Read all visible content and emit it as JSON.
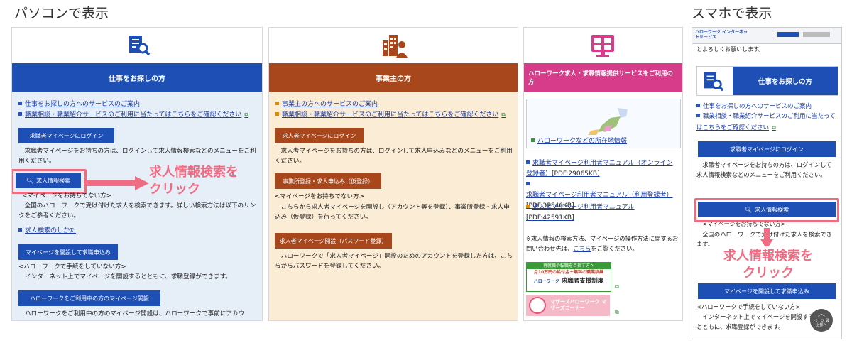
{
  "captions": {
    "pc": "パソコンで表示",
    "sp": "スマホで表示"
  },
  "colors": {
    "job_seeker": "#1d4fb4",
    "employer": "#a8471b",
    "hw_service": "#d63c8a",
    "callout": "#f06c82"
  },
  "p1": {
    "title": "仕事をお探しの方",
    "icon": "document-search-icon",
    "link1": "仕事をお探しの方へのサービスのご案内",
    "link2": "職業相談・職業紹介サービスのご利用に当たってはこちらをご確認ください",
    "login_btn": "求職者マイページにログイン",
    "login_desc": "求職者マイページをお持ちの方は、ログインして求人情報検索などのメニューをご利用ください。",
    "search_btn": "求人情報検索",
    "no_mypage": "<マイページをお持ちでない方>",
    "search_desc": "全国のハローワークで受け付けた求人を検索できます。詳しい検索方法は以下のリンクをご参考ください。",
    "link3": "求人検索のしかた",
    "open_btn": "マイページを開設して求職申込み",
    "no_visit": "<ハローワークで手続をしていない方>",
    "open_desc": "インターネット上でマイページを開設するとともに、求職登録ができます。",
    "hw_btn": "ハローワークをご利用中の方のマイページ開設",
    "hw_desc": "ハローワークをご利用中の方のマイページ開設は、ハローワークで事前にアカウ"
  },
  "p2": {
    "title": "事業主の方",
    "icon": "building-person-icon",
    "link1": "事業主の方へのサービスのご案内",
    "link2": "職業相談・職業紹介サービスのご利用に当たってはこちらをご確認ください",
    "login_btn": "求人者マイページにログイン",
    "login_desc": "求人者マイページをお持ちの方は、ログインして求人申込みなどのメニューをご利用ください。",
    "reg_btn": "事業所登録・求人申込み（仮登録）",
    "no_mypage": "<マイページをお持ちでない方>",
    "reg_desc": "こちらから求人者マイページを開設し（アカウント等を登録）、事業所登録・求人申込み（仮登録）を行ってください。",
    "open_btn": "求人者マイページ開設（パスワード登録）",
    "open_desc": "ハローワークで「求人者マイページ」開設のためのアカウントを登録した方は、こちらからパスワードを登録してください。"
  },
  "p3": {
    "title": "ハローワーク求人・求職情報提供サービスをご利用の方",
    "icon": "monitor-grid-icon",
    "map_link": "ハローワークなどの所在地情報",
    "m1": "求職者マイページ利用者マニュアル（オンライン登録者）",
    "m1_size": "[PDF:29065KB]",
    "m2": "求職者マイページ利用者マニュアル（利用登録者）",
    "m2_size": "[PDF:32546KB]",
    "m3": "求人者マイページ利用者マニュアル",
    "m3_size": "[PDF:42591KB]",
    "note": "※求人情報の検索方法、マイページの操作方法に関するお問い合わせ先は、",
    "note_link": "こちら",
    "note_end": "をご覧ください。",
    "banner1_top": "再就職や転職を目指す方へ",
    "banner1_mid": "月10万円の給付金＋無料の職業訓練",
    "banner1_bottom": "求職者支援制度",
    "banner1_brand": "ハローワーク",
    "banner2": "マザーズハローワーク マザーズコーナー"
  },
  "p4": {
    "site_name": "ハローワーク インターネットサービス",
    "cut_text": "とよろしくお願いします。",
    "title": "仕事をお探しの方",
    "link1": "仕事をお探しの方へのサービスのご案内",
    "link2": "職業相談・職業紹介サービスのご利用に当たってはこちらをご確認ください",
    "login_btn": "求職者マイページにログイン",
    "login_desc": "求職者マイページをお持ちの方は、ログインして求人情報検索などのメニューをご利用ください。",
    "search_btn": "求人情報検索",
    "no_mypage": "<マイページをお持ちでない方>",
    "search_desc": "全国のハローワークで受け付けた求人を検索できます。",
    "open_btn": "マイページを開設して求職申込み",
    "no_visit": "<ハローワークで手続をしていない方>",
    "open_desc": "インターネット上でマイページを開設するとともに、求職登録ができます。",
    "top_btn": "ページ 最上部へ"
  },
  "callouts": {
    "line1": "求人情報検索を",
    "line2": "クリック"
  }
}
